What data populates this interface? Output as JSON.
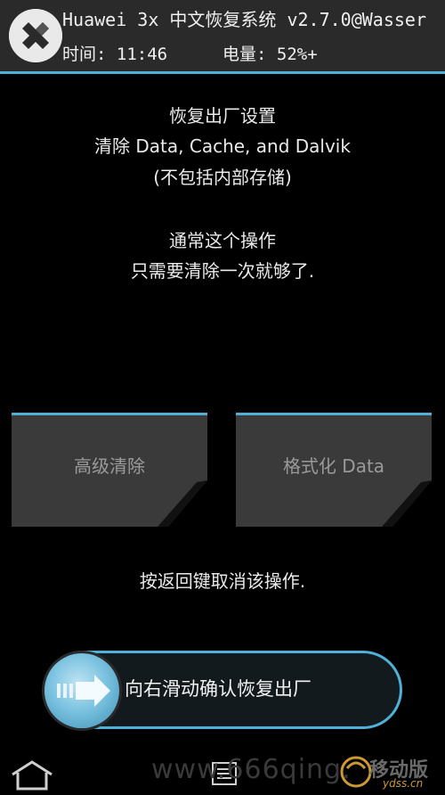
{
  "header": {
    "title": "Huawei 3x 中文恢复系统 v2.7.0@Wasser",
    "time_label": "时间: 11:46",
    "battery_label": "电量: 52%+"
  },
  "message": {
    "line1": "恢复出厂设置",
    "line2": "清除 Data, Cache, and Dalvik",
    "line3": "(不包括内部存储)",
    "line4": "通常这个操作",
    "line5": "只需要清除一次就够了."
  },
  "buttons": {
    "advanced_wipe": "高级清除",
    "format_data": "格式化 Data"
  },
  "cancel_hint": "按返回键取消该操作.",
  "slider": {
    "label": "向右滑动确认恢复出厂"
  },
  "watermark": {
    "site": "www.666qing.",
    "brand": "移动版",
    "brand_sub": "ydss.cn"
  },
  "colors": {
    "accent": "#4fb1d8",
    "header_bg": "#2a2a2a",
    "button_bg": "#3a3a3a"
  }
}
